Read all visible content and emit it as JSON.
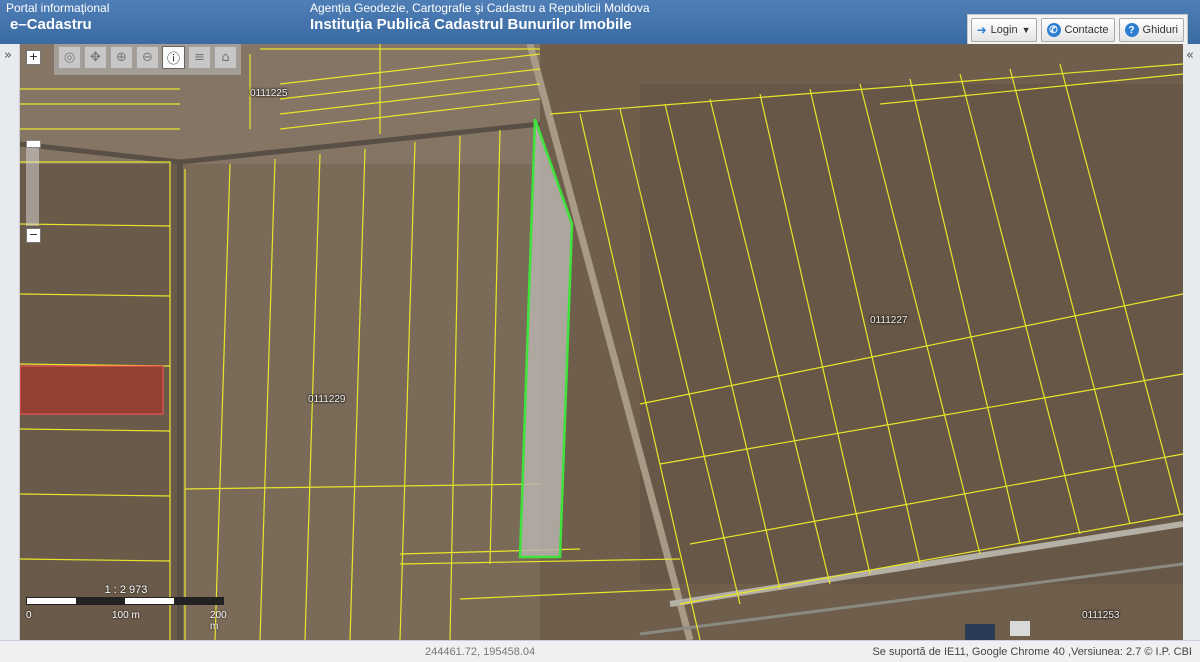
{
  "header": {
    "portal_small": "Portal informaţional",
    "portal_big": "e–Cadastru",
    "agency": "Agenţia Geodezie, Cartografie şi Cadastru a Republicii Moldova",
    "institution": "Instituţia Publică Cadastrul Bunurilor Imobile",
    "buttons": {
      "login": "Login",
      "contacts": "Contacte",
      "guides": "Ghiduri"
    }
  },
  "sidebar": {
    "expand_left": "»",
    "expand_right": "«"
  },
  "map": {
    "zoom_in": "+",
    "zoom_out": "−",
    "zoom_level": 0.0,
    "toolbar_tools": [
      "pan",
      "move",
      "zoom-in",
      "zoom-out",
      "identify",
      "layers",
      "print"
    ],
    "active_tool": "identify",
    "sector_labels": {
      "top_left": "0111225",
      "middle": "0111229",
      "right": "0111227",
      "bottom_right": "0111253"
    },
    "scale": {
      "label": "1 : 2 973",
      "ticks": [
        "0",
        "100 m",
        "200 m"
      ]
    },
    "colors": {
      "parcel_lines": "#e8e62a",
      "selected_parcel": "#3fe33c",
      "highlighted_parcel": "#b23b32",
      "soil": "#6f5e4c"
    }
  },
  "footer": {
    "coordinates": "244461.72, 195458.04",
    "support": "Se suportă de IE11, Google Chrome 40 ,Versiunea: 2.7 © I.P. CBI"
  }
}
